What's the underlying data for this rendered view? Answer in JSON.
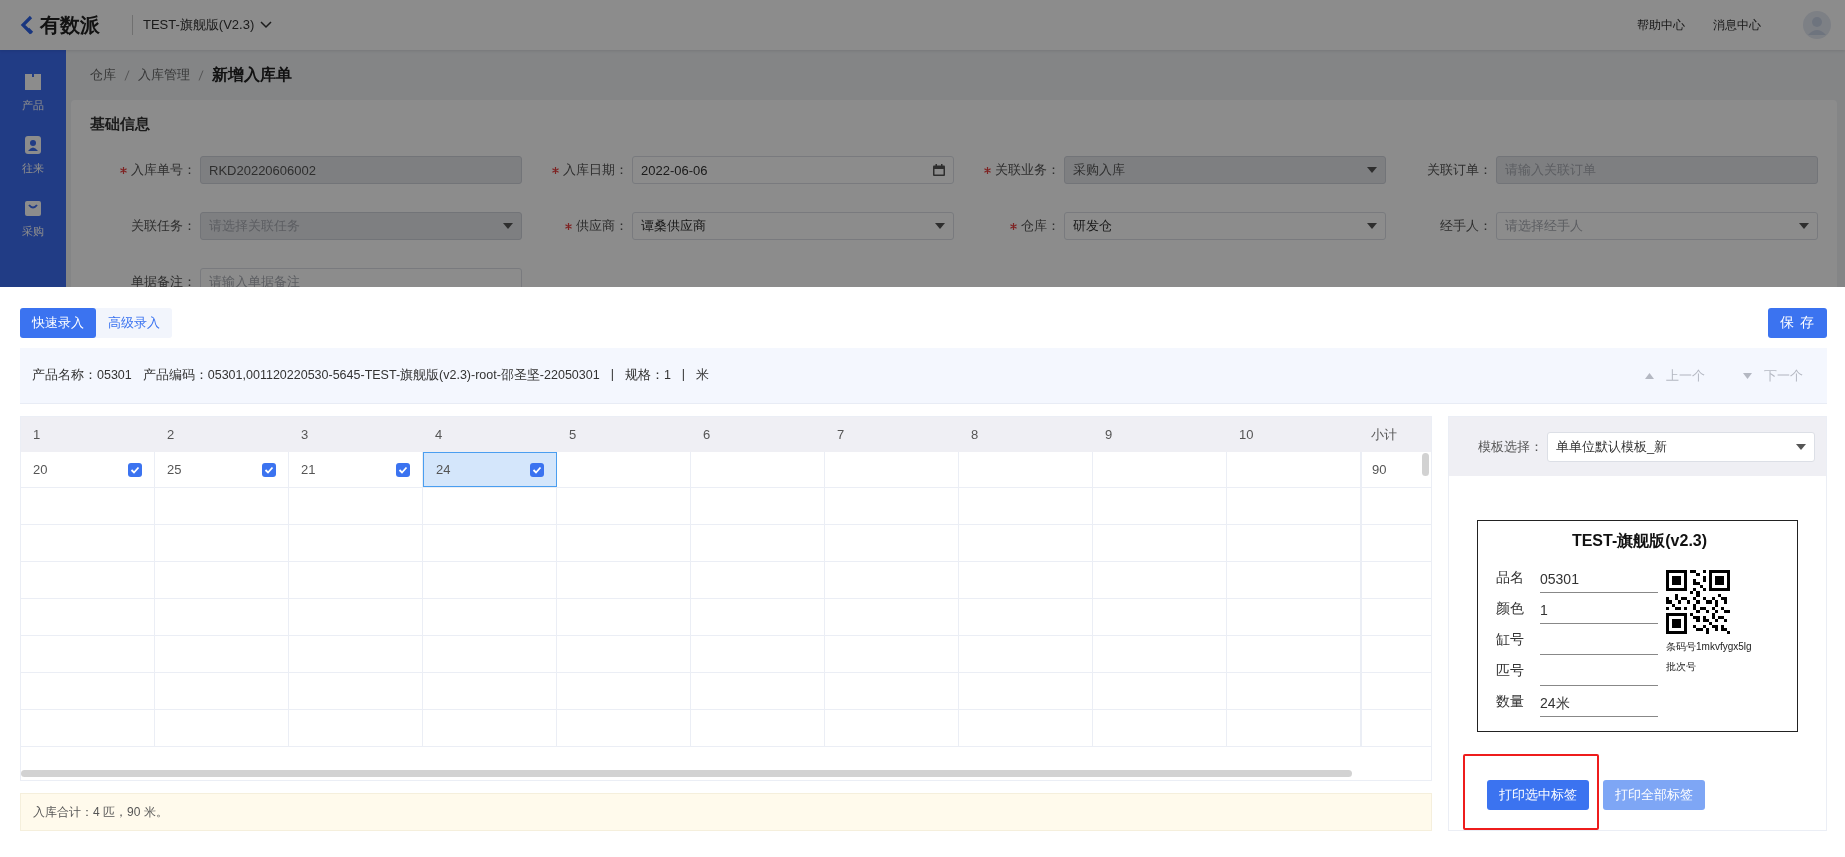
{
  "header": {
    "logo": "有数派",
    "workspace": "TEST-旗舰版(V2.3)",
    "links": [
      "帮助中心",
      "消息中心"
    ]
  },
  "sidebar": {
    "items": [
      {
        "label": "产品"
      },
      {
        "label": "往来"
      },
      {
        "label": "采购"
      }
    ]
  },
  "breadcrumb": [
    "仓库",
    "入库管理",
    "新增入库单"
  ],
  "form": {
    "title": "基础信息",
    "fields": [
      {
        "label": "入库单号：",
        "required": true,
        "kind": "input",
        "value": "RKD20220606002",
        "disabled": true
      },
      {
        "label": "入库日期：",
        "required": true,
        "kind": "date",
        "value": "2022-06-06",
        "disabled": false
      },
      {
        "label": "关联业务：",
        "required": true,
        "kind": "select",
        "value": "采购入库",
        "disabled": true
      },
      {
        "label": "关联订单：",
        "required": false,
        "kind": "input",
        "placeholder": "请输入关联订单",
        "disabled": true
      },
      {
        "label": "关联任务：",
        "required": false,
        "kind": "select",
        "placeholder": "请选择关联任务",
        "disabled": true
      },
      {
        "label": "供应商：",
        "required": true,
        "kind": "select",
        "value": "谭桑供应商",
        "disabled": false
      },
      {
        "label": "仓库：",
        "required": true,
        "kind": "select",
        "value": "研发仓",
        "disabled": false
      },
      {
        "label": "经手人：",
        "required": false,
        "kind": "select",
        "placeholder": "请选择经手人",
        "disabled": false
      },
      {
        "label": "单据备注：",
        "required": false,
        "kind": "textarea",
        "placeholder": "请输入单据备注",
        "disabled": false
      }
    ]
  },
  "dialog": {
    "tabs": [
      {
        "label": "快速录入",
        "selected": true
      },
      {
        "label": "高级录入",
        "selected": false
      }
    ],
    "save_button": "保 存",
    "product_info": [
      "产品名称：05301",
      "产品编码：05301,001120220530-5645-TEST-旗舰版(v2.3)-root-邵圣坚-22050301",
      "|",
      "规格：1",
      "|",
      "米"
    ],
    "nav": [
      {
        "label": "上一个",
        "kind": "up",
        "disabled": true
      },
      {
        "label": "下一个",
        "kind": "down",
        "disabled": true
      }
    ],
    "grid": {
      "columns": [
        "1",
        "2",
        "3",
        "4",
        "5",
        "6",
        "7",
        "8",
        "9",
        "10"
      ],
      "subtotal_column": "小计",
      "rows": [
        {
          "cells": [
            {
              "value": "20",
              "checked": true,
              "selected": false
            },
            {
              "value": "25",
              "checked": true,
              "selected": false
            },
            {
              "value": "21",
              "checked": true,
              "selected": false
            },
            {
              "value": "24",
              "checked": true,
              "selected": true
            }
          ],
          "subtotal": "90"
        }
      ]
    },
    "summary": "入库合计：4 匹，90 米。",
    "template": {
      "label": "模板选择：",
      "value": "单单位默认模板_新"
    },
    "label_preview": {
      "title": "TEST-旗舰版(v2.3)",
      "fields": [
        {
          "label": "品名",
          "value": "05301"
        },
        {
          "label": "颜色",
          "value": "1"
        },
        {
          "label": "缸号"
        },
        {
          "label": "匹号"
        },
        {
          "label": "数量",
          "value": "24米"
        }
      ],
      "barcode_text": "条码号1mkvfygx5lg",
      "batch_label": "批次号"
    },
    "buttons": [
      {
        "label": "打印选中标签",
        "kind": "primary",
        "highlighted": true
      },
      {
        "label": "打印全部标签",
        "kind": "light",
        "highlighted": false
      }
    ]
  }
}
